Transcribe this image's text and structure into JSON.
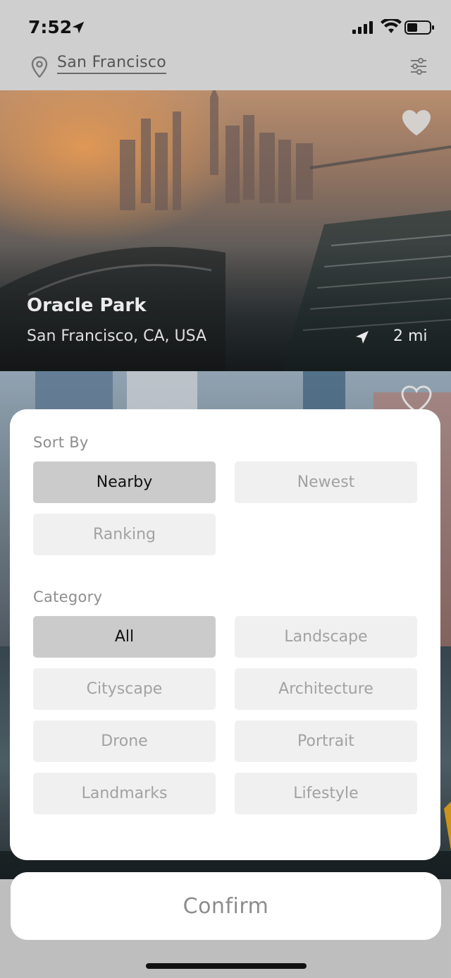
{
  "status_bar": {
    "time": "7:52"
  },
  "location": {
    "city": "San Francisco"
  },
  "featured": {
    "title": "Oracle Park",
    "subtitle": "San Francisco, CA, USA",
    "distance": "2 mi"
  },
  "sheet": {
    "sort_label": "Sort By",
    "sort_options": [
      {
        "label": "Nearby",
        "selected": true
      },
      {
        "label": "Newest",
        "selected": false
      },
      {
        "label": "Ranking",
        "selected": false
      }
    ],
    "category_label": "Category",
    "category_options": [
      {
        "label": "All",
        "selected": true
      },
      {
        "label": "Landscape",
        "selected": false
      },
      {
        "label": "Cityscape",
        "selected": false
      },
      {
        "label": "Architecture",
        "selected": false
      },
      {
        "label": "Drone",
        "selected": false
      },
      {
        "label": "Portrait",
        "selected": false
      },
      {
        "label": "Landmarks",
        "selected": false
      },
      {
        "label": "Lifestyle",
        "selected": false
      }
    ]
  },
  "confirm_label": "Confirm",
  "icons": {
    "location_arrow": "location-arrow-icon",
    "signal": "signal-icon",
    "wifi": "wifi-icon",
    "battery": "battery-icon",
    "pin": "map-pin-icon",
    "filter": "sliders-icon",
    "heart": "heart-icon",
    "navigation": "navigation-arrow-icon"
  }
}
